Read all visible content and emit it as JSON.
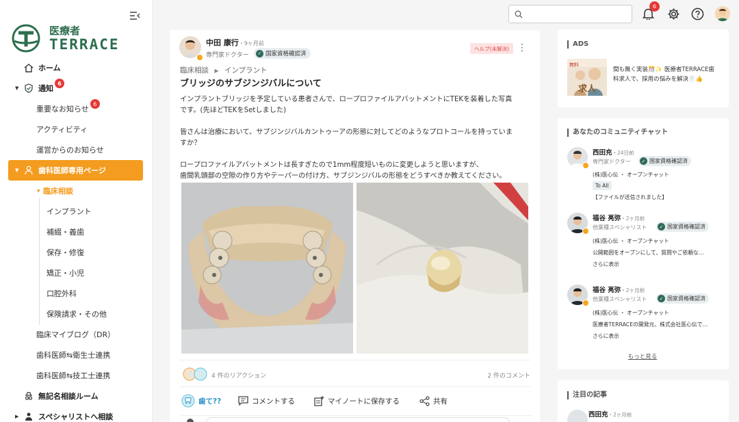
{
  "logo": {
    "top": "医療者",
    "bottom": "TERRACE"
  },
  "sidebar": {
    "home": "ホーム",
    "notice": "通知",
    "notice_badge": "6",
    "important": "重要なお知らせ",
    "important_badge": "6",
    "activity": "アクティビティ",
    "ops_notice": "運営からのお知らせ",
    "dentist_page": "歯科医師専用ページ",
    "clinical": "臨床相談",
    "sub": [
      "インプラント",
      "補綴・義歯",
      "保存・修復",
      "矯正・小児",
      "口腔外科",
      "保険請求・その他"
    ],
    "blog": "臨床マイブログ（DR）",
    "hygienist": "歯科医師⇆衛生士連携",
    "technician": "歯科医師⇆技工士連携",
    "anonymous": "無記名相談ルーム",
    "specialist": "スペシャリストへ相談"
  },
  "header": {
    "search_placeholder": "",
    "notif_badge": "6"
  },
  "post": {
    "author": "中田 康行",
    "time": "・9ヶ月前",
    "role": "専門家ドクター",
    "verified": "国家資格確認済",
    "help_tag": "ヘルプ(未解決)",
    "category": "臨床相談",
    "subcategory": "インプラント",
    "title": "ブリッジのサブジンジバルについて",
    "lines": [
      "インプラントブリッジを予定している患者さんで、ロープロファイルアバットメントにTEKを装着した写真",
      "です。(先ほどTEKをSetしました)",
      "皆さんは治療において、サブジンジバルカントゥーアの形態に対してどのようなプロトコールを持っていま",
      "すか？",
      "ロープロファイルアバットメントは長すぎたので1mm程度短いものに変更しようと思いますが、",
      "歯間乳頭部の空隙の作り方やテーパーの付け方、サブジンジバルの形態をどうすべきか教えてください。"
    ],
    "reactions": "4 件のリアクション",
    "comments": "2 件のコメント",
    "actions": {
      "react": "歯て??",
      "comment": "コメントする",
      "save": "マイノートに保存する",
      "share": "共有"
    }
  },
  "ads": {
    "heading": "ADS",
    "text": "間も無く実装🎊✨ 医療者TERRACE歯科求人で、採用の悩みを解決🦷👍",
    "img_tag": "無料",
    "img_text": "求人"
  },
  "community": {
    "heading": "あなたのコミュニティチャット",
    "chats": [
      {
        "name": "西田充",
        "time": "・24日前",
        "role": "専門家ドクター",
        "verified": "国家資格確認済",
        "group": "(株)医心伝 ・ オープンチャット",
        "tag": "To All",
        "msg": "【ファイルが送信されました】",
        "more": ""
      },
      {
        "name": "福谷 亮弥",
        "time": "・2ヶ月前",
        "role": "他業種スペシャリスト",
        "verified": "国家資格確認済",
        "group": "(株)医心伝 ・ オープンチャット",
        "tag": "",
        "msg": "公開範囲をオープンにして、質問やご依頼な…",
        "more": "さらに表示"
      },
      {
        "name": "福谷 亮弥",
        "time": "・2ヶ月前",
        "role": "他業種スペシャリスト",
        "verified": "国家資格確認済",
        "group": "(株)医心伝 ・ オープンチャット",
        "tag": "",
        "msg": "医療者TERRACEの開発元、株式会社医心伝で…",
        "more": "さらに表示"
      }
    ],
    "more_link": "もっと見る"
  },
  "featured": {
    "heading": "注目の記事",
    "name": "西田充",
    "time": "・2ヶ月前"
  },
  "colors": {
    "accent": "#f39c1f",
    "brand": "#2d6e4e",
    "badge": "#e53935"
  }
}
